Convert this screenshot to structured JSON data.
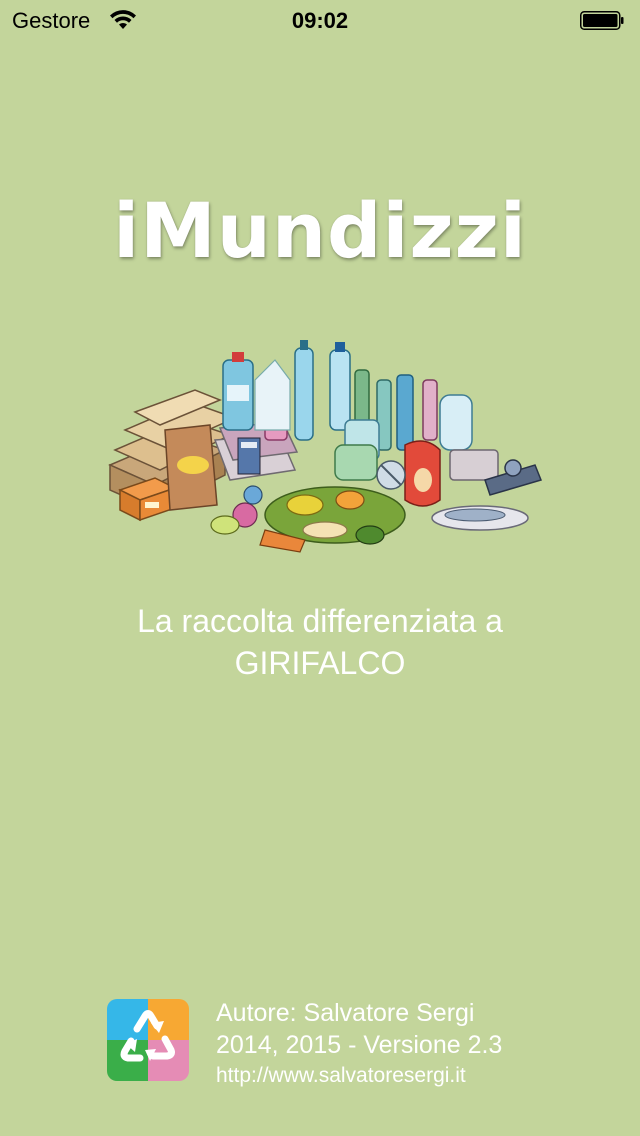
{
  "status_bar": {
    "carrier": "Gestore",
    "time": "09:02"
  },
  "app": {
    "title": "iMundizzi",
    "subtitle_line1": "La raccolta differenziata a",
    "subtitle_line2": "GIRIFALCO"
  },
  "footer": {
    "author": "Autore: Salvatore Sergi",
    "version": "2014, 2015 - Versione 2.3",
    "website": "http://www.salvatoresergi.it"
  },
  "icons": {
    "wifi": "wifi-icon",
    "battery": "battery-icon",
    "recycle_logo": "recycle-logo-icon",
    "illustration": "waste-illustration"
  },
  "colors": {
    "background": "#c3d59b",
    "text": "#ffffff",
    "logo_blue": "#35b7e8",
    "logo_orange": "#f7a833",
    "logo_green": "#3aae49",
    "logo_pink": "#e58cb5"
  }
}
